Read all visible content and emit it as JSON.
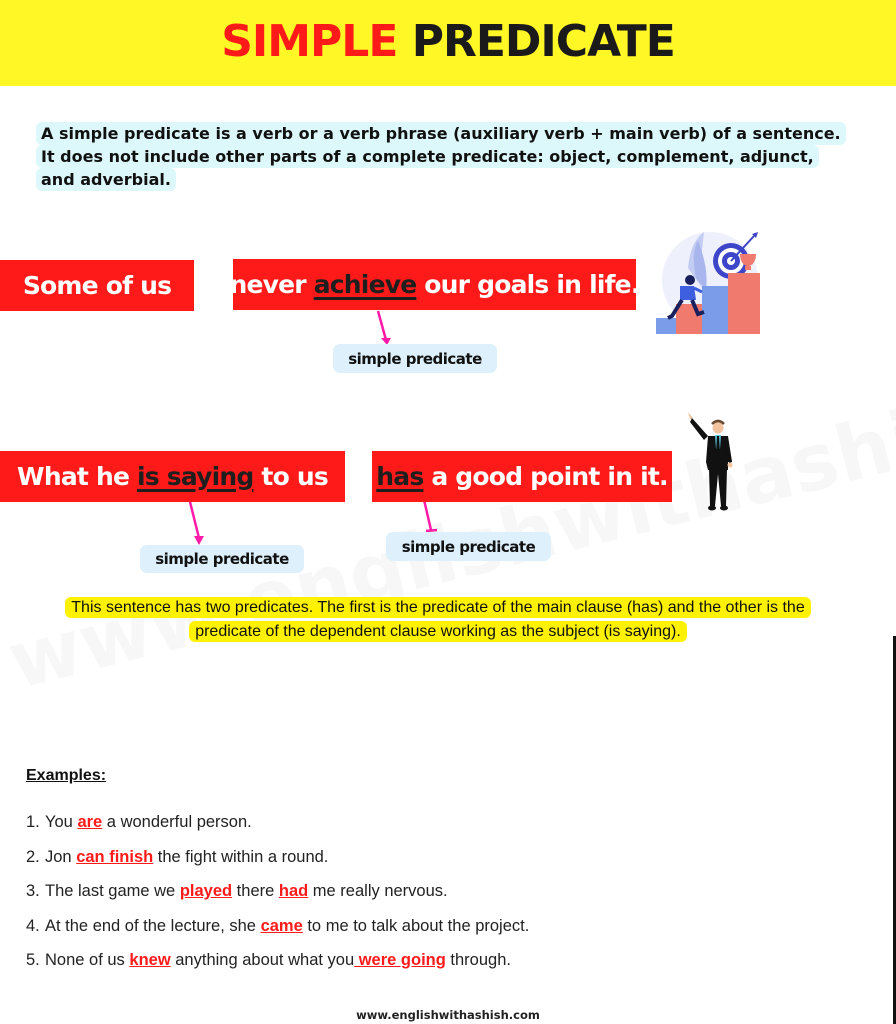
{
  "header": {
    "title_part1": "SIMPLE",
    "title_part2": "PREDICATE",
    "colors": {
      "background": "#fff726",
      "accent": "#ff1a1a",
      "dark": "#1a1a1a"
    }
  },
  "definition": "A simple predicate is a verb or a verb phrase (auxiliary verb + main verb) of a sentence. It does not include other parts of a complete predicate: object, complement, adjunct, and adverbial.",
  "example1": {
    "subject": "Some of us",
    "predicate_before": "never ",
    "predicate_highlight": "achieve",
    "predicate_after": " our goals in life.",
    "tag": "simple predicate",
    "illustration": "person-climbing-stairs-to-target-icon"
  },
  "example2": {
    "subject_before": "What he ",
    "subject_highlight": "is saying",
    "subject_after": " to us",
    "predicate_highlight": "has",
    "predicate_after": " a good point in it.",
    "tag_left": "simple predicate",
    "tag_right": "simple predicate",
    "illustration": "businessman-pointing-icon"
  },
  "note": "This sentence has two predicates. The first is the predicate of the main clause (has) and the other is the predicate of the dependent clause working as the subject (is saying).",
  "examples": {
    "heading": "Examples:",
    "items": [
      {
        "num": "1.",
        "parts": [
          {
            "t": "You "
          },
          {
            "t": "are",
            "v": true
          },
          {
            "t": " a wonderful person."
          }
        ]
      },
      {
        "num": "2.",
        "parts": [
          {
            "t": "Jon "
          },
          {
            "t": "can finish",
            "v": true
          },
          {
            "t": " the fight within a round."
          }
        ]
      },
      {
        "num": "3.",
        "parts": [
          {
            "t": "The last game we "
          },
          {
            "t": "played",
            "v": true
          },
          {
            "t": " there "
          },
          {
            "t": "had",
            "v": true
          },
          {
            "t": " me really nervous."
          }
        ]
      },
      {
        "num": "4.",
        "parts": [
          {
            "t": "At the end of the lecture, she "
          },
          {
            "t": "came",
            "v": true
          },
          {
            "t": " to me to talk about the project."
          }
        ]
      },
      {
        "num": "5.",
        "parts": [
          {
            "t": "None of us "
          },
          {
            "t": "knew",
            "v": true
          },
          {
            "t": " anything about what you"
          },
          {
            "t": " were going",
            "v": true
          },
          {
            "t": " through."
          }
        ]
      }
    ]
  },
  "watermark": "www.englishwithashish.com",
  "footer": "www.englishwithashish.com"
}
